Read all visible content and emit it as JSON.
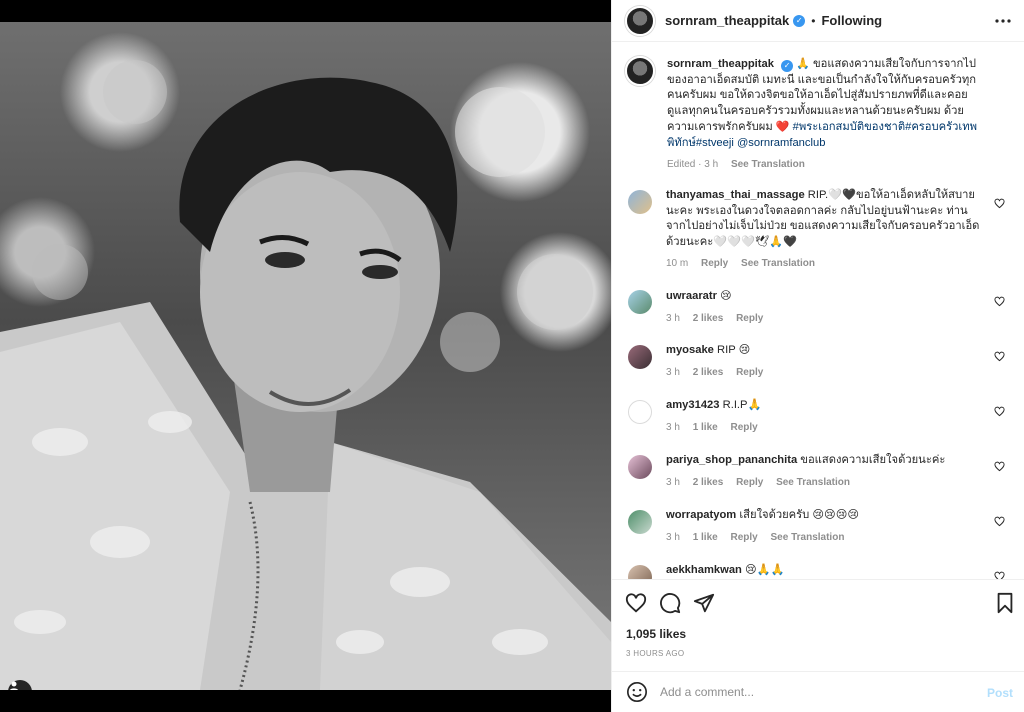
{
  "header": {
    "username": "sornram_theappitak",
    "separator": "•",
    "follow_label": "Following",
    "more_icon": "ellipsis-icon"
  },
  "caption": {
    "username": "sornram_theappitak",
    "emoji_prefix": "🙏",
    "text": "ขอแสดงความเสียใจกับการจากไปของอาอาเอ็ดสมบัติ เมทะนี และขอเป็นกำลังใจให้กับครอบครัวทุกคนครับผม ขอให้ดวงจิตขอให้อาเอ็ดไปสู่สัมปรายภพที่ดีและคอยดูแลทุกคนในครอบครัวรวมทั้งผมและหลานด้วยนะครับผม ด้วยความเคารพรักครับผม",
    "heart": "❤️",
    "tags": "#พระเอกสมบัติของชาติ#ครอบครัวเทพพิทักษ์#stveeji",
    "mention": "@sornramfanclub",
    "edited": "Edited · 3 h",
    "see_translation": "See Translation"
  },
  "comments": [
    {
      "user": "thanyamas_thai_massage",
      "text": "RIP.🤍🖤ขอให้อาเอ็ดหลับให้สบายนะคะ พระเองในดวงใจตลอดกาลค่ะ กลับไปอยู่บนฟ้านะคะ ท่านจากไปอย่างไม่เจ็บไม่ป่วย ขอแสดงความเสียใจกับครอบครัวอาเอ็ดด้วยนะคะ🤍🤍🤍🕊🙏🖤",
      "time": "10 m",
      "likes": "",
      "reply": "Reply",
      "translate": "See Translation"
    },
    {
      "user": "uwraaratr",
      "text": "😢",
      "time": "3 h",
      "likes": "2 likes",
      "reply": "Reply",
      "translate": ""
    },
    {
      "user": "myosake",
      "text": "RIP 😢",
      "time": "3 h",
      "likes": "2 likes",
      "reply": "Reply",
      "translate": ""
    },
    {
      "user": "amy31423",
      "text": "R.I.P🙏",
      "time": "3 h",
      "likes": "1 like",
      "reply": "Reply",
      "translate": ""
    },
    {
      "user": "pariya_shop_pananchita",
      "text": "ขอแสดงความเสียใจด้วยนะค่ะ",
      "time": "3 h",
      "likes": "2 likes",
      "reply": "Reply",
      "translate": "See Translation"
    },
    {
      "user": "worrapatyom",
      "text": "เสียใจด้วยครับ 😢😢😢😢",
      "time": "3 h",
      "likes": "1 like",
      "reply": "Reply",
      "translate": "See Translation"
    },
    {
      "user": "aekkhamkwan",
      "text": "😢🙏🙏",
      "time": "",
      "likes": "",
      "reply": "",
      "translate": ""
    }
  ],
  "actions": {
    "like_icon": "heart-icon",
    "comment_icon": "comment-icon",
    "share_icon": "paper-plane-icon",
    "save_icon": "bookmark-icon",
    "likes_count": "1,095 likes",
    "time_ago": "3 HOURS AGO"
  },
  "add_comment": {
    "emoji_icon": "smiley-icon",
    "placeholder": "Add a comment...",
    "post_label": "Post"
  }
}
